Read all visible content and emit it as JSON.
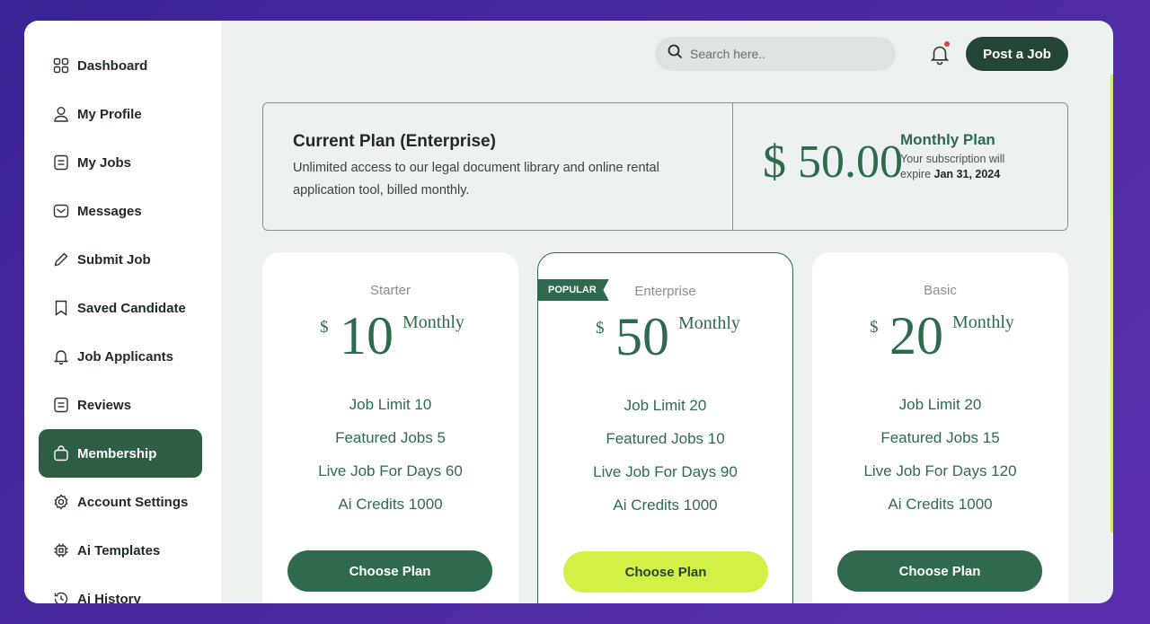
{
  "sidebar": {
    "items": [
      {
        "label": "Dashboard",
        "icon": "dashboard-icon"
      },
      {
        "label": "My Profile",
        "icon": "user-icon"
      },
      {
        "label": "My Jobs",
        "icon": "document-icon"
      },
      {
        "label": "Messages",
        "icon": "mail-icon"
      },
      {
        "label": "Submit Job",
        "icon": "pen-icon"
      },
      {
        "label": "Saved Candidate",
        "icon": "bookmark-icon"
      },
      {
        "label": "Job Applicants",
        "icon": "bell-icon"
      },
      {
        "label": "Reviews",
        "icon": "document-icon"
      },
      {
        "label": "Membership",
        "icon": "bag-icon"
      },
      {
        "label": "Account Settings",
        "icon": "gear-icon"
      },
      {
        "label": "Ai Templates",
        "icon": "chip-icon"
      },
      {
        "label": "Ai History",
        "icon": "history-icon"
      }
    ],
    "active": "Membership"
  },
  "header": {
    "search_placeholder": "Search here..",
    "post_button": "Post a Job"
  },
  "current_plan": {
    "title": "Current Plan (Enterprise)",
    "description": "Unlimited access to our legal document library and online rental application tool, billed monthly.",
    "price": "$ 50.00",
    "plan_label": "Monthly Plan",
    "expiry_text": "Your subscription will expire",
    "expiry_date": "Jan 31, 2024"
  },
  "plans": [
    {
      "name": "Starter",
      "currency": "$",
      "amount": "10",
      "period": "Monthly",
      "features": [
        "Job Limit 10",
        "Featured Jobs 5",
        "Live Job For Days 60",
        "Ai Credits 1000"
      ],
      "button": "Choose Plan",
      "popular": false
    },
    {
      "name": "Enterprise",
      "currency": "$",
      "amount": "50",
      "period": "Monthly",
      "features": [
        "Job Limit 20",
        "Featured Jobs 10",
        "Live Job For Days 90",
        "Ai Credits 1000"
      ],
      "button": "Choose Plan",
      "popular": true,
      "badge": "POPULAR"
    },
    {
      "name": "Basic",
      "currency": "$",
      "amount": "20",
      "period": "Monthly",
      "features": [
        "Job Limit 20",
        "Featured Jobs 15",
        "Live Job For Days 120",
        "Ai Credits 1000"
      ],
      "button": "Choose Plan",
      "popular": false
    }
  ],
  "colors": {
    "brand_dark": "#244634",
    "brand": "#2f6a4f",
    "accent_lime": "#d3f046",
    "background": "#edf1ef"
  }
}
